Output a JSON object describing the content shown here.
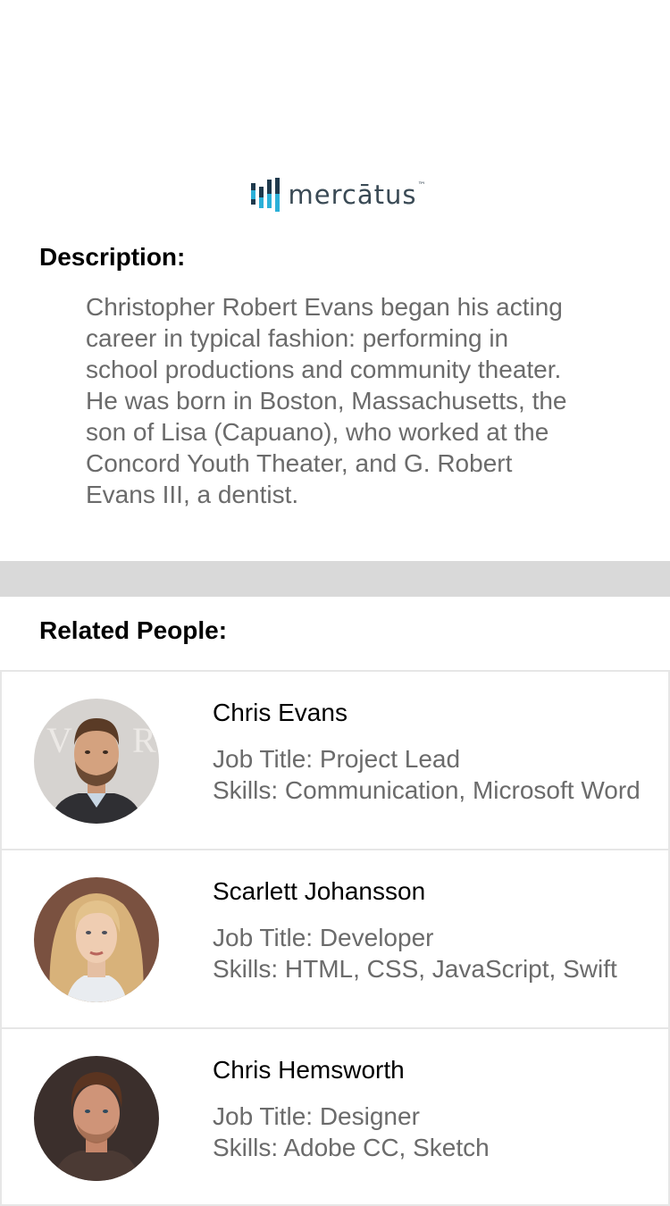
{
  "brand": {
    "name": "mercātus",
    "tm": "™",
    "colors": {
      "bar_dark": "#1f3a4d",
      "bar_light": "#2bb0d8",
      "text": "#3a4a55"
    }
  },
  "description": {
    "title": "Description:",
    "body": "Christopher Robert Evans began his acting career in typical fashion: performing in school productions and community theater. He was born in Boston, Massachusetts, the son of Lisa (Capuano), who worked at the Concord Youth Theater, and G. Robert Evans III, a dentist."
  },
  "related": {
    "title": "Related People:",
    "people": [
      {
        "name": "Chris Evans",
        "job": "Job Title: Project Lead",
        "skills": "Skills: Communication, Microsoft Word"
      },
      {
        "name": "Scarlett Johansson",
        "job": "Job Title: Developer",
        "skills": "Skills: HTML, CSS, JavaScript, Swift"
      },
      {
        "name": "Chris Hemsworth",
        "job": "Job Title: Designer",
        "skills": "Skills: Adobe CC, Sketch"
      }
    ]
  }
}
